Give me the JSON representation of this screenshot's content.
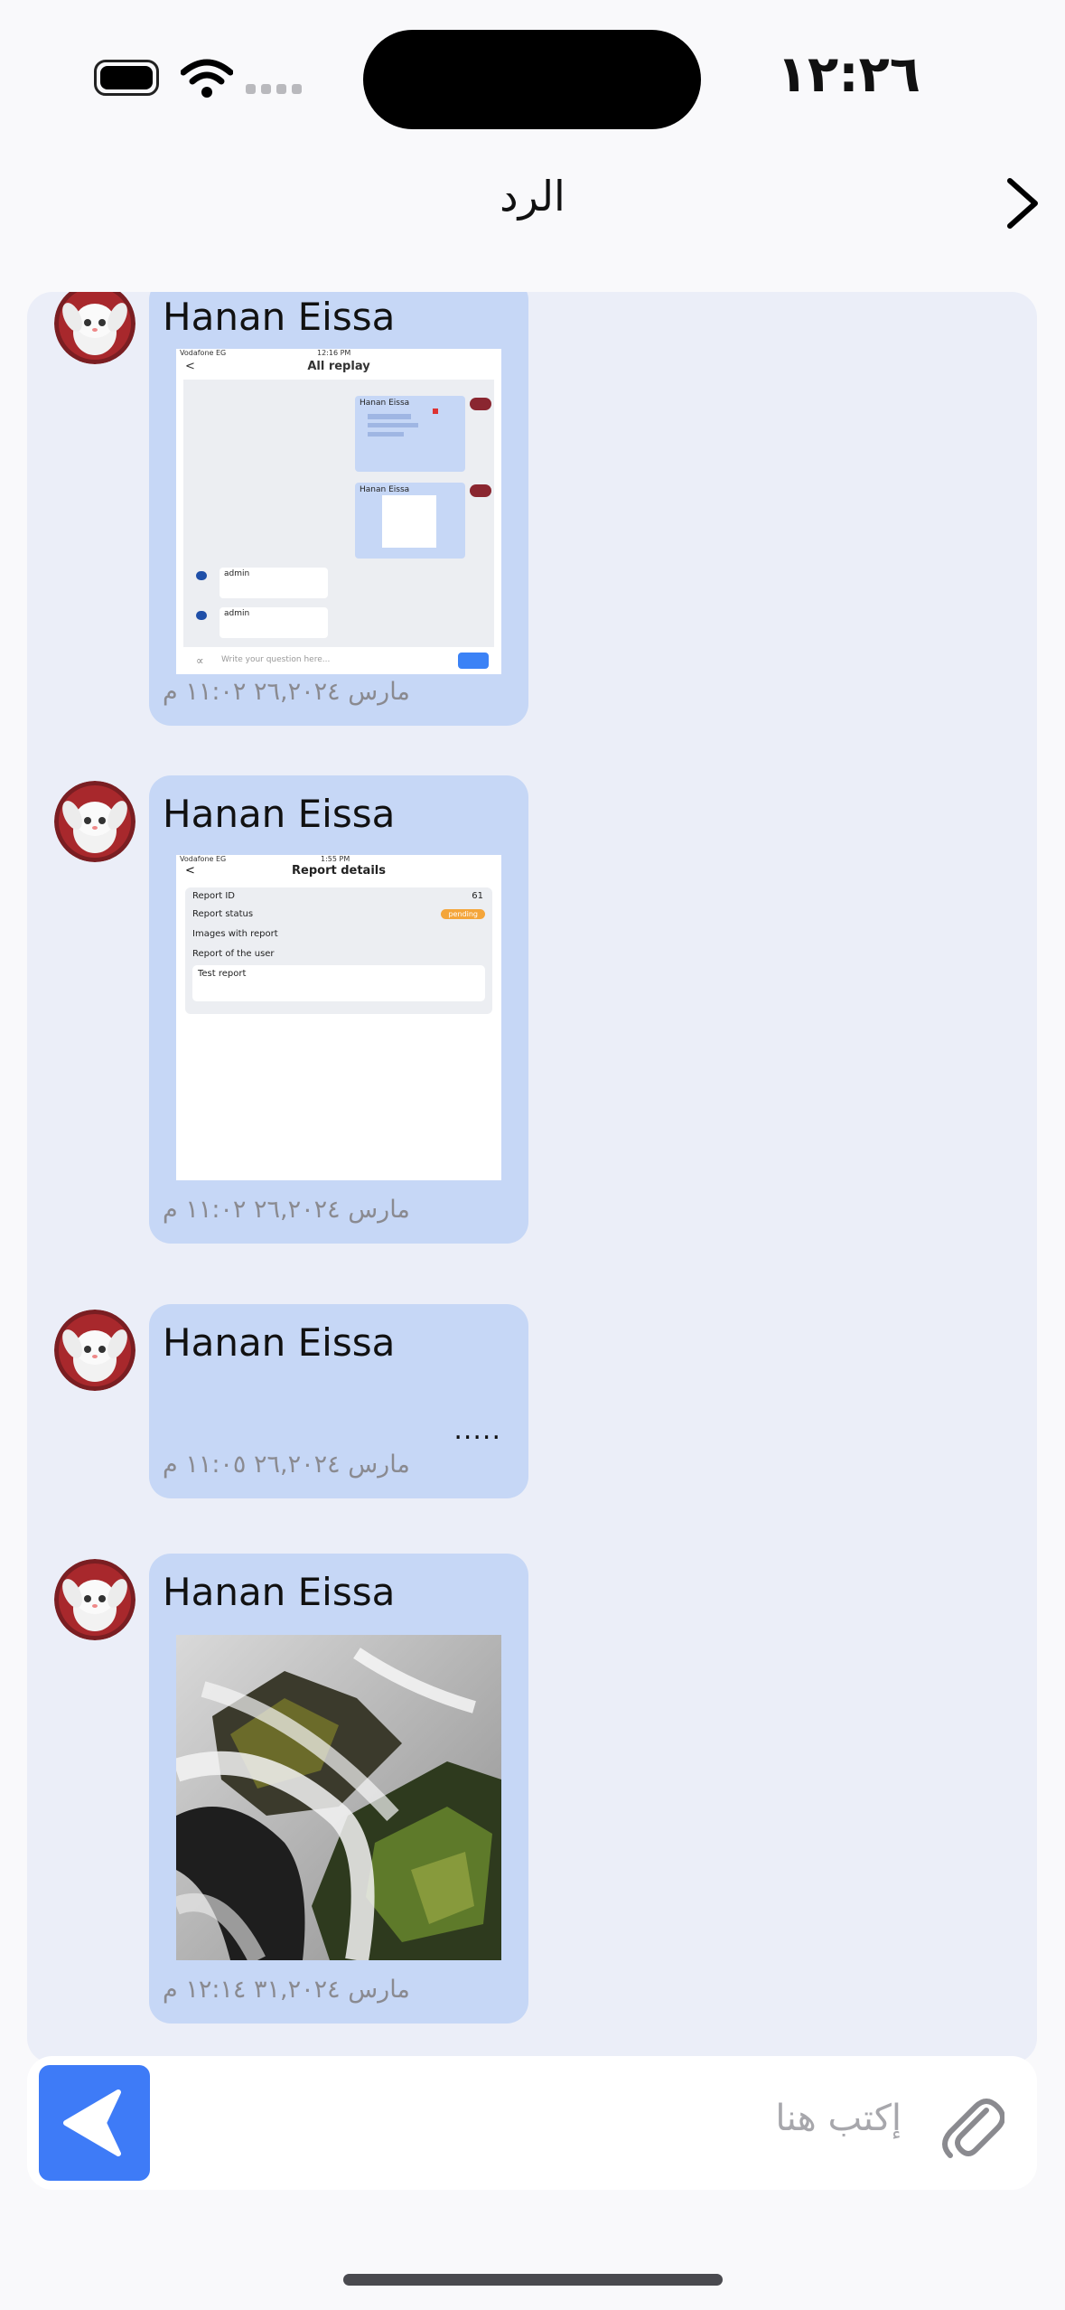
{
  "status_bar": {
    "time": "١٢:٢٦"
  },
  "header": {
    "title": "الرد"
  },
  "messages": [
    {
      "sender": "Hanan Eissa",
      "timestamp": "مارس ٢٦,٢٠٢٤ ١١:٠٢ م",
      "attachment": {
        "kind": "screenshot",
        "title": "All replay",
        "status_left": "Vodafone EG",
        "status_time": "12:16 PM",
        "bubbles": [
          {
            "sender": "Hanan Eissa"
          },
          {
            "sender": "Hanan Eissa"
          }
        ],
        "admin_label": "admin",
        "input_placeholder": "Write your question here..."
      }
    },
    {
      "sender": "Hanan Eissa",
      "timestamp": "مارس ٢٦,٢٠٢٤ ١١:٠٢ م",
      "attachment": {
        "kind": "screenshot",
        "title": "Report details",
        "status_left": "Vodafone EG",
        "status_time": "1:55 PM",
        "report_id_label": "Report ID",
        "report_id_value": "61",
        "status_label": "Report status",
        "status_value": "pending",
        "images_label": "Images with report",
        "user_report_label": "Report of the user",
        "user_report_text": "Test report"
      }
    },
    {
      "sender": "Hanan Eissa",
      "body": ".....",
      "timestamp": "مارس ٢٦,٢٠٢٤ ١١:٠٥ م"
    },
    {
      "sender": "Hanan Eissa",
      "attachment": {
        "kind": "photo"
      },
      "timestamp": "مارس ٣١,٢٠٢٤ ١٢:١٤ م"
    }
  ],
  "composer": {
    "placeholder": "إكتب هنا",
    "send_icon": "send-icon",
    "attach_icon": "paperclip-icon"
  },
  "colors": {
    "accent": "#3e7bf7",
    "bubble": "#c6d7f6",
    "panel": "#ebeef8",
    "pending": "#f4a53a"
  }
}
